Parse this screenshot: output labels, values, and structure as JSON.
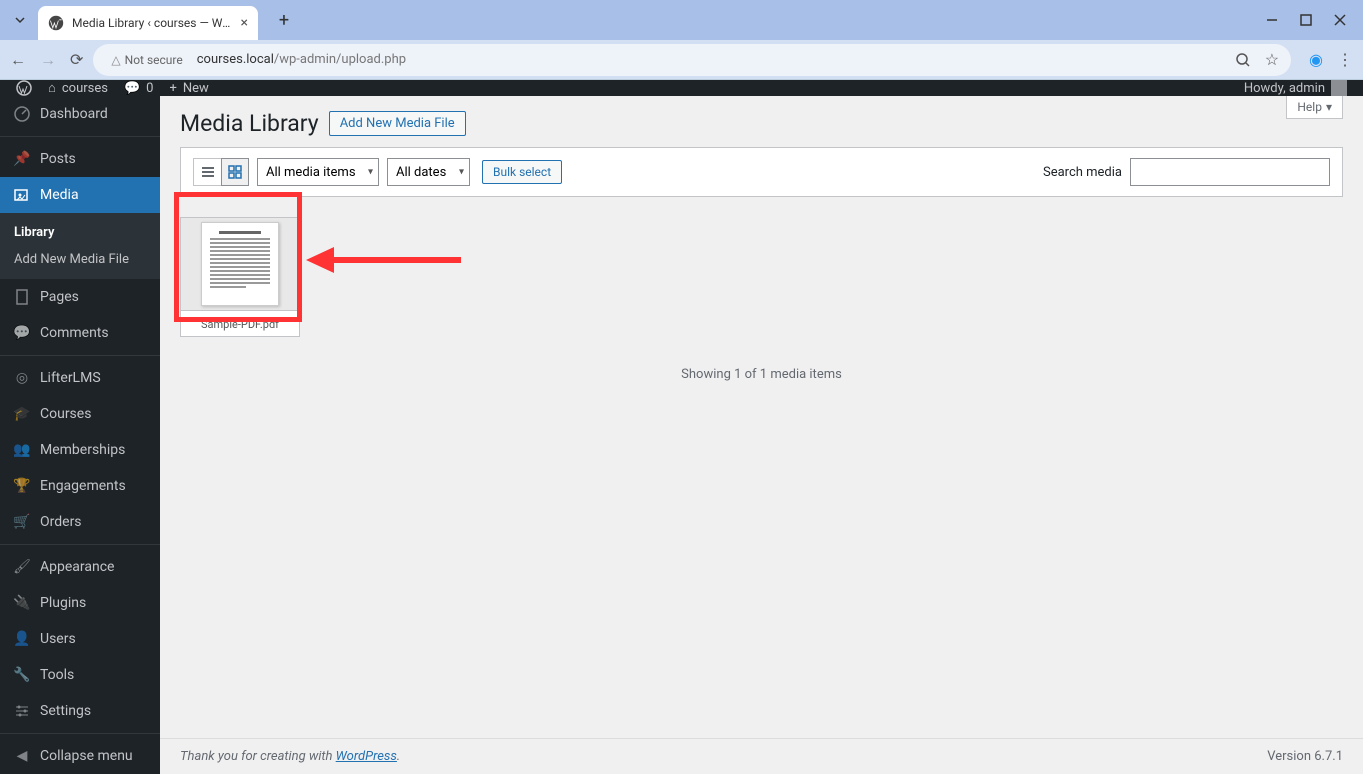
{
  "browser": {
    "tab_title": "Media Library ‹ courses — Wor",
    "url_host": "courses.local",
    "url_path": "/wp-admin/upload.php",
    "security_label": "Not secure"
  },
  "adminbar": {
    "site_name": "courses",
    "comments_count": "0",
    "new_label": "New",
    "howdy": "Howdy, admin"
  },
  "menu": {
    "dashboard": "Dashboard",
    "posts": "Posts",
    "media": "Media",
    "media_sub_library": "Library",
    "media_sub_add": "Add New Media File",
    "pages": "Pages",
    "comments": "Comments",
    "lifterlms": "LifterLMS",
    "courses": "Courses",
    "memberships": "Memberships",
    "engagements": "Engagements",
    "orders": "Orders",
    "appearance": "Appearance",
    "plugins": "Plugins",
    "users": "Users",
    "tools": "Tools",
    "settings": "Settings",
    "collapse": "Collapse menu"
  },
  "page": {
    "title": "Media Library",
    "add_new": "Add New Media File",
    "help": "Help",
    "filter_type": "All media items",
    "filter_date": "All dates",
    "bulk_select": "Bulk select",
    "search_label": "Search media",
    "search_value": "",
    "status": "Showing 1 of 1 media items",
    "thankyou_prefix": "Thank you for creating with ",
    "thankyou_link": "WordPress",
    "version": "Version 6.7.1"
  },
  "media_items": [
    {
      "filename": "Sample-PDF.pdf"
    }
  ]
}
